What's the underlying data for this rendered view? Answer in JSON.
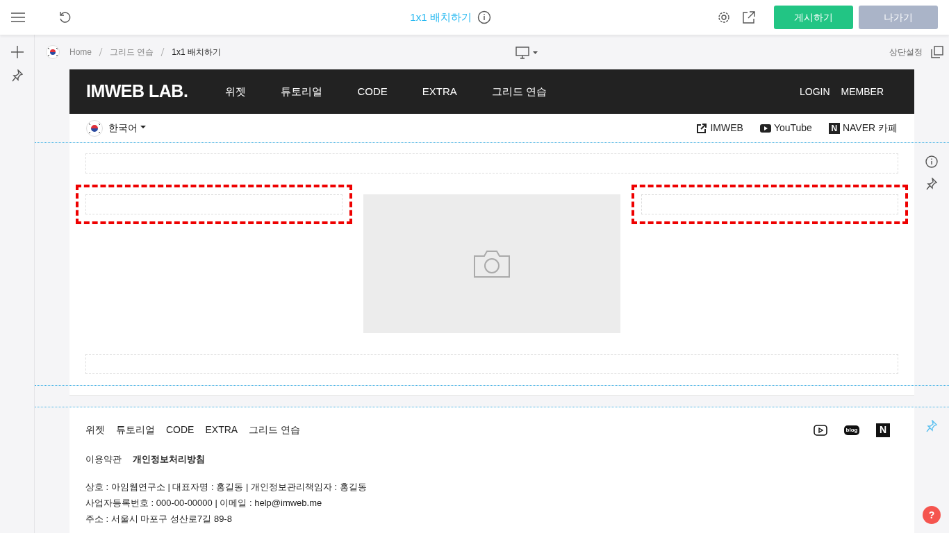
{
  "toolbar": {
    "title": "1x1 배치하기",
    "publish_button": "게시하기",
    "exit_button": "나가기"
  },
  "breadcrumb": [
    {
      "label": "Home",
      "selected": false
    },
    {
      "label": "그리드 연습",
      "selected": false
    },
    {
      "label": "1x1 배치하기",
      "selected": true
    }
  ],
  "header_settings": "상단설정",
  "site": {
    "logo": "IMWEB LAB.",
    "menu": [
      "위젯",
      "튜토리얼",
      "CODE",
      "EXTRA",
      "그리드 연습"
    ],
    "account": [
      "LOGIN",
      "MEMBER"
    ],
    "language": "한국어",
    "links": [
      {
        "kind": "external",
        "label": "IMWEB"
      },
      {
        "kind": "youtube",
        "label": "YouTube"
      },
      {
        "kind": "naver",
        "label": "NAVER 카페",
        "icon_text": "N"
      }
    ]
  },
  "grid": [
    {
      "kind": "empty",
      "selected": false
    },
    {
      "kind": "empty",
      "selected": true
    },
    {
      "kind": "picture",
      "selected": false
    },
    {
      "kind": "empty",
      "selected": true
    },
    {
      "kind": "empty",
      "selected": false
    }
  ],
  "footer": {
    "menu": [
      "위젯",
      "튜토리얼",
      "CODE",
      "EXTRA",
      "그리드 연습"
    ],
    "policies": [
      {
        "label": "이용약관",
        "bold": false
      },
      {
        "label": "개인정보처리방침",
        "bold": true
      }
    ],
    "info": [
      "상호 : 아임웹연구소 | 대표자명 : 홍길동 | 개인정보관리책임자 : 홍길동",
      "사업자등록번호 : 000-00-00000 | 이메일 : help@imweb.me",
      "주소 : 서울시 마포구 성산로7길 89-8"
    ],
    "social": [
      {
        "kind": "youtube"
      },
      {
        "kind": "blog",
        "icon_text": "blog"
      },
      {
        "kind": "naver",
        "icon_text": "N"
      }
    ]
  },
  "help": "?"
}
